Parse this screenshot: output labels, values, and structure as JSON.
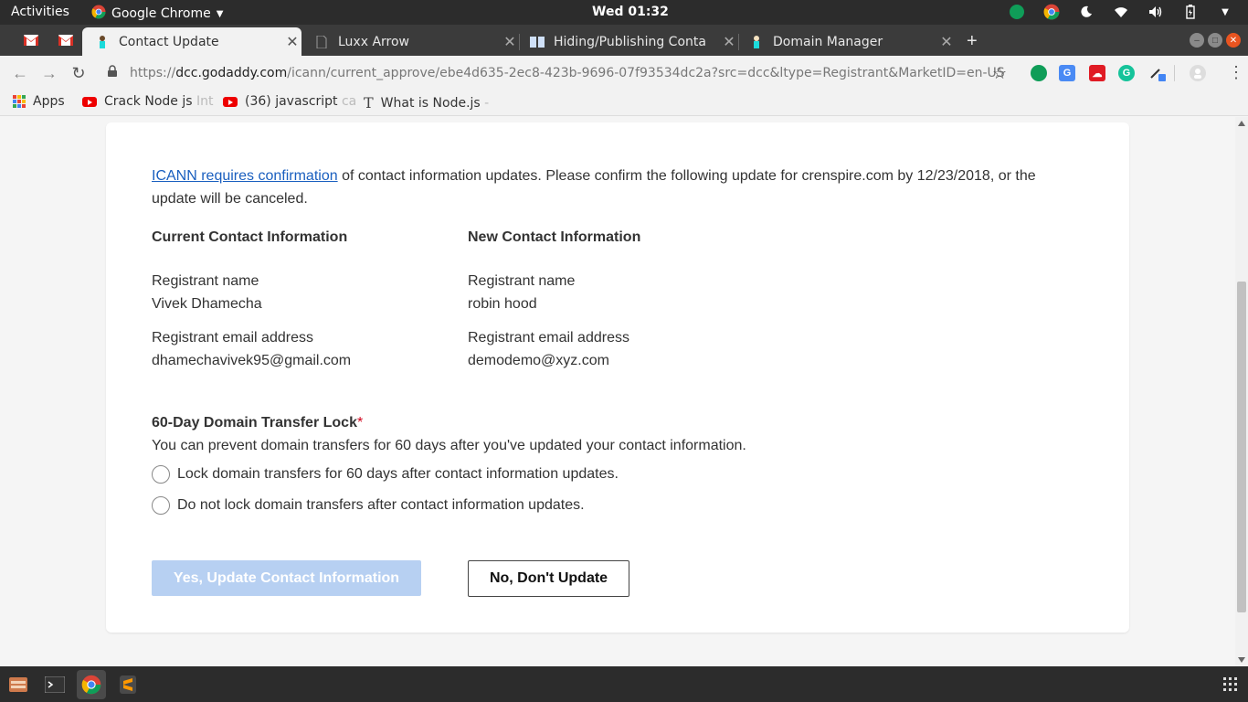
{
  "system_bar": {
    "activities": "Activities",
    "app_name": "Google Chrome",
    "clock": "Wed 01:32"
  },
  "tabs": [
    {
      "title": "Contact Update",
      "active": true,
      "favicon": "godaddy-icon"
    },
    {
      "title": "Luxx Arrow",
      "active": false,
      "favicon": "page-icon"
    },
    {
      "title": "Hiding/Publishing Conta",
      "active": false,
      "favicon": "book-icon"
    },
    {
      "title": "Domain Manager",
      "active": false,
      "favicon": "godaddy-icon"
    }
  ],
  "address_bar": {
    "scheme": "https://",
    "host": "dcc.godaddy.com",
    "path": "/icann/current_approve/ebe4d635-2ec8-423b-9696-07f93534dc2a?src=dcc&ltype=Registrant&MarketID=en-US"
  },
  "bookmarks": [
    {
      "label": "Apps",
      "faded": "",
      "icon": "apps-grid-icon"
    },
    {
      "label": "Crack Node js ",
      "faded": "Int",
      "icon": "youtube-icon"
    },
    {
      "label": "(36) javascript ",
      "faded": "ca",
      "icon": "youtube-icon"
    },
    {
      "label": "What is Node.js ",
      "faded": "-",
      "icon": "medium-t-icon"
    }
  ],
  "page": {
    "intro_link": "ICANN requires confirmation",
    "intro_text": " of contact information updates. Please confirm the following update for crenspire.com by 12/23/2018, or the update will be canceled.",
    "current": {
      "heading": "Current Contact Information",
      "name_label": "Registrant name",
      "name_value": "Vivek Dhamecha",
      "email_label": "Registrant email address",
      "email_value": "dhamechavivek95@gmail.com"
    },
    "new": {
      "heading": "New Contact Information",
      "name_label": "Registrant name",
      "name_value": "robin hood",
      "email_label": "Registrant email address",
      "email_value": "demodemo@xyz.com"
    },
    "lock": {
      "heading": "60-Day Domain Transfer Lock",
      "required_mark": "*",
      "description": "You can prevent domain transfers for 60 days after you've updated your contact information.",
      "option_lock": "Lock domain transfers for 60 days after contact information updates.",
      "option_no_lock": "Do not lock domain transfers after contact information updates."
    },
    "btn_yes": "Yes, Update Contact Information",
    "btn_no": "No, Don't Update"
  },
  "colors": {
    "link": "#1a5fbf",
    "primary_disabled": "#b7d0f2",
    "required": "#d0021b"
  }
}
